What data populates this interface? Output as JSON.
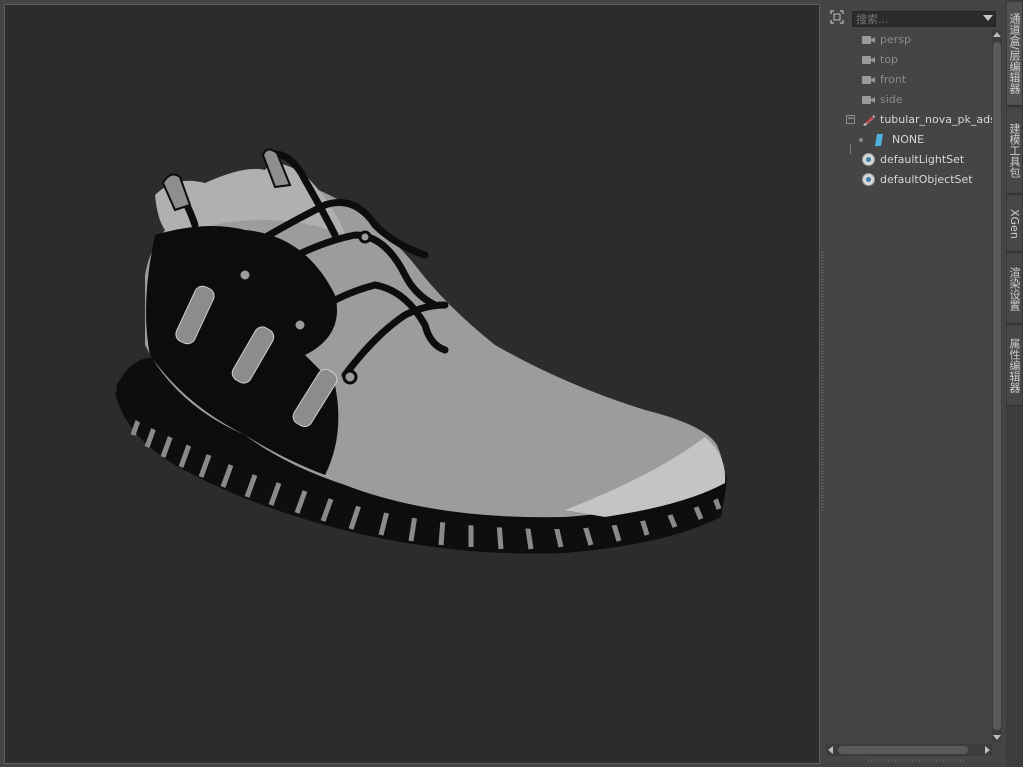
{
  "search": {
    "placeholder": "搜索..."
  },
  "outliner": {
    "items": [
      {
        "label": "persp",
        "kind": "camera"
      },
      {
        "label": "top",
        "kind": "camera"
      },
      {
        "label": "front",
        "kind": "camera"
      },
      {
        "label": "side",
        "kind": "camera"
      },
      {
        "label": "tubular_nova_pk_ads",
        "kind": "mesh"
      },
      {
        "label": "NONE",
        "kind": "shape"
      },
      {
        "label": "defaultLightSet",
        "kind": "set"
      },
      {
        "label": "defaultObjectSet",
        "kind": "set"
      }
    ]
  },
  "side_tabs": [
    "通道盒/层编辑器",
    "建模工具包",
    "XGen",
    "渲染设置",
    "属性编辑器"
  ],
  "icons": {
    "filter": "outliner-filter-icon",
    "camera": "camera-icon",
    "mesh": "mesh-transform-icon",
    "shape": "shape-node-icon",
    "set": "object-set-icon"
  },
  "colors": {
    "viewport_bg": "#2c2c2c",
    "panel_bg": "#454545",
    "model_gray": "#9a9a9a",
    "model_dark": "#0d0d0d"
  }
}
